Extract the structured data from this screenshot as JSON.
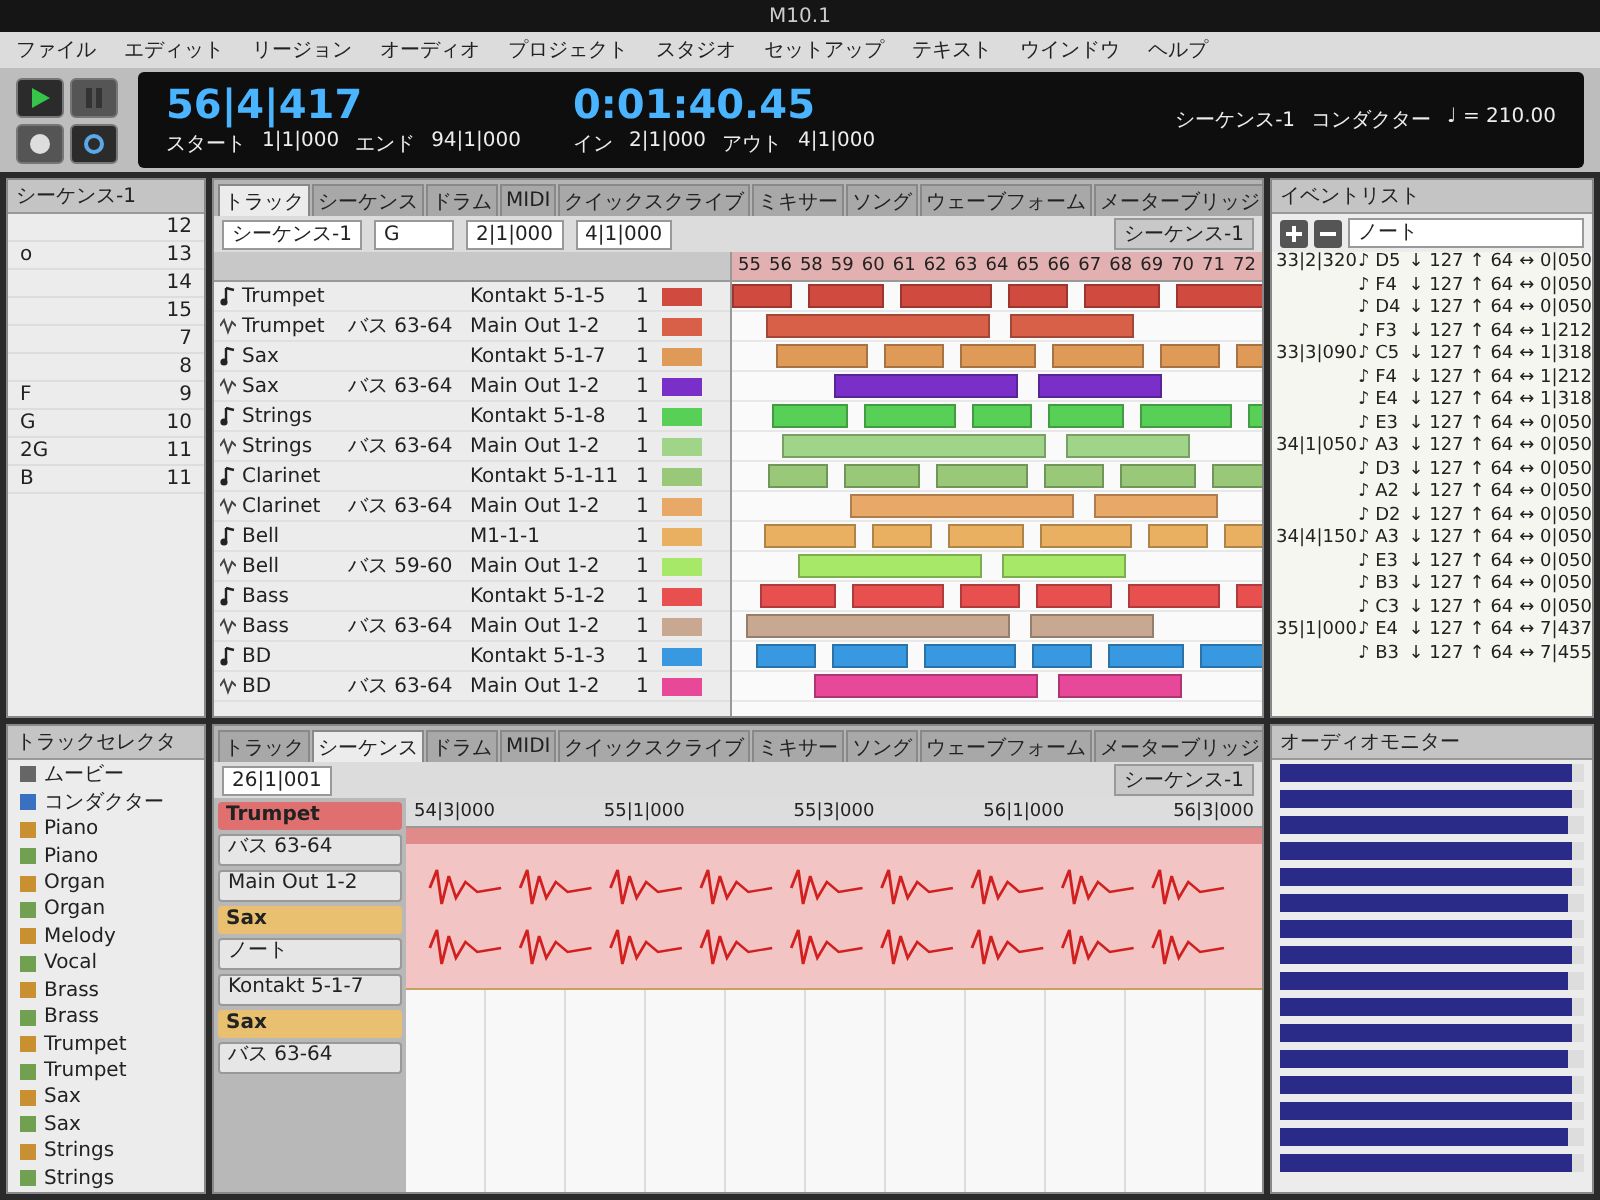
{
  "window": {
    "title": "M10.1"
  },
  "menu": [
    "ファイル",
    "エディット",
    "リージョン",
    "オーディオ",
    "プロジェクト",
    "スタジオ",
    "セットアップ",
    "テキスト",
    "ウインドウ",
    "ヘルプ"
  ],
  "transport": {
    "buttons": [
      {
        "kind": "play",
        "on": true
      },
      {
        "kind": "pause",
        "on": false
      },
      {
        "kind": "record",
        "on": false
      },
      {
        "kind": "loop",
        "on": true
      }
    ],
    "counter": "56|4|417",
    "start_label": "スタート",
    "start": "1|1|000",
    "end_label": "エンド",
    "end": "94|1|000",
    "time": "0:01:40.45",
    "in_label": "イン",
    "in": "2|1|000",
    "out_label": "アウト",
    "out": "4|1|000",
    "sequence": "シーケンス-1",
    "conductor": "コンダクター",
    "tempo": "♩ = 210.00"
  },
  "sequence_list": {
    "title": "シーケンス-1",
    "rows": [
      {
        "number": "12"
      },
      {
        "name": "o",
        "number": "13"
      },
      {
        "number": "14"
      },
      {
        "number": "15"
      },
      {
        "number": "7"
      },
      {
        "number": "8"
      },
      {
        "name": "F",
        "number": "9"
      },
      {
        "name": "G",
        "number": "10"
      },
      {
        "name": "2G",
        "number": "11"
      },
      {
        "name": "B",
        "number": "11"
      }
    ]
  },
  "tracks_window": {
    "title": "シーケンス-1",
    "tabs": [
      {
        "label": "トラック",
        "selected": true
      },
      {
        "label": "シーケンス",
        "selected": false
      },
      {
        "label": "ドラム",
        "selected": false
      },
      {
        "label": "MIDI",
        "selected": false
      },
      {
        "label": "クイックスクライブ",
        "selected": false
      },
      {
        "label": "ミキサー",
        "selected": false
      },
      {
        "label": "ソング",
        "selected": false
      },
      {
        "label": "ウェーブフォーム",
        "selected": false
      },
      {
        "label": "メーターブリッジ",
        "selected": false
      }
    ],
    "sequence_select": "シーケンス-1",
    "filter_select": "G",
    "from": "2|1|000",
    "to": "4|1|000",
    "ruler": [
      "55",
      "56",
      "58",
      "59",
      "60",
      "61",
      "62",
      "63",
      "64",
      "65",
      "66",
      "67",
      "68",
      "69",
      "70",
      "71",
      "72"
    ],
    "tracks": [
      {
        "kind": "midi",
        "name": "Trumpet",
        "device": "Kontakt 5-1-5",
        "channel": "1",
        "color": "#d04a40"
      },
      {
        "kind": "audio",
        "name": "Trumpet",
        "output": "バス 63-64",
        "device": "Main Out 1-2",
        "channel": "1",
        "color": "#d86048"
      },
      {
        "kind": "midi",
        "name": "Sax",
        "device": "Kontakt 5-1-7",
        "channel": "1",
        "color": "#e09a58"
      },
      {
        "kind": "audio",
        "name": "Sax",
        "output": "バス 63-64",
        "device": "Main Out 1-2",
        "channel": "1",
        "color": "#7a30c8"
      },
      {
        "kind": "midi",
        "name": "Strings",
        "device": "Kontakt 5-1-8",
        "channel": "1",
        "color": "#58d058"
      },
      {
        "kind": "audio",
        "name": "Strings",
        "output": "バス 63-64",
        "device": "Main Out 1-2",
        "channel": "1",
        "color": "#a0d488"
      },
      {
        "kind": "midi",
        "name": "Clarinet",
        "device": "Kontakt 5-1-11",
        "channel": "1",
        "color": "#98c878"
      },
      {
        "kind": "audio",
        "name": "Clarinet",
        "output": "バス 63-64",
        "device": "Main Out 1-2",
        "channel": "1",
        "color": "#e8a868"
      },
      {
        "kind": "midi",
        "name": "Bell",
        "device": "M1-1-1",
        "channel": "1",
        "color": "#e8b060"
      },
      {
        "kind": "audio",
        "name": "Bell",
        "output": "バス 59-60",
        "device": "Main Out 1-2",
        "channel": "1",
        "color": "#a8e868"
      },
      {
        "kind": "midi",
        "name": "Bass",
        "device": "Kontakt 5-1-2",
        "channel": "1",
        "color": "#e85050"
      },
      {
        "kind": "audio",
        "name": "Bass",
        "output": "バス 63-64",
        "device": "Main Out 1-2",
        "channel": "1",
        "color": "#c8a890"
      },
      {
        "kind": "midi",
        "name": "BD",
        "device": "Kontakt 5-1-3",
        "channel": "1",
        "color": "#3898e0"
      },
      {
        "kind": "audio",
        "name": "BD",
        "output": "バス 63-64",
        "device": "Main Out 1-2",
        "channel": "1",
        "color": "#e84898"
      }
    ]
  },
  "event_list": {
    "title": "イベントリスト",
    "filter": "ノート",
    "groups": [
      {
        "time": "33|2|320",
        "events": [
          {
            "note": "♪ D5",
            "on": "↓ 127",
            "off": "↑ 64",
            "dur": "↔ 0|050"
          },
          {
            "note": "♪ F4",
            "on": "↓ 127",
            "off": "↑ 64",
            "dur": "↔ 0|050"
          },
          {
            "note": "♪ D4",
            "on": "↓ 127",
            "off": "↑ 64",
            "dur": "↔ 0|050"
          },
          {
            "note": "♪ F3",
            "on": "↓ 127",
            "off": "↑ 64",
            "dur": "↔ 1|212"
          }
        ]
      },
      {
        "time": "33|3|090",
        "events": [
          {
            "note": "♪ C5",
            "on": "↓ 127",
            "off": "↑ 64",
            "dur": "↔ 1|318"
          },
          {
            "note": "♪ F4",
            "on": "↓ 127",
            "off": "↑ 64",
            "dur": "↔ 1|212"
          },
          {
            "note": "♪ E4",
            "on": "↓ 127",
            "off": "↑ 64",
            "dur": "↔ 1|318"
          },
          {
            "note": "♪ E3",
            "on": "↓ 127",
            "off": "↑ 64",
            "dur": "↔ 0|050"
          }
        ]
      },
      {
        "time": "34|1|050",
        "events": [
          {
            "note": "♪ A3",
            "on": "↓ 127",
            "off": "↑ 64",
            "dur": "↔ 0|050"
          },
          {
            "note": "♪ D3",
            "on": "↓ 127",
            "off": "↑ 64",
            "dur": "↔ 0|050"
          },
          {
            "note": "♪ A2",
            "on": "↓ 127",
            "off": "↑ 64",
            "dur": "↔ 0|050"
          },
          {
            "note": "♪ D2",
            "on": "↓ 127",
            "off": "↑ 64",
            "dur": "↔ 0|050"
          }
        ]
      },
      {
        "time": "34|4|150",
        "events": [
          {
            "note": "♪ A3",
            "on": "↓ 127",
            "off": "↑ 64",
            "dur": "↔ 0|050"
          },
          {
            "note": "♪ E3",
            "on": "↓ 127",
            "off": "↑ 64",
            "dur": "↔ 0|050"
          },
          {
            "note": "♪ B3",
            "on": "↓ 127",
            "off": "↑ 64",
            "dur": "↔ 0|050"
          },
          {
            "note": "♪ C3",
            "on": "↓ 127",
            "off": "↑ 64",
            "dur": "↔ 0|050"
          }
        ]
      },
      {
        "time": "35|1|000",
        "events": [
          {
            "note": "♪ E4",
            "on": "↓ 127",
            "off": "↑ 64",
            "dur": "↔ 7|437"
          },
          {
            "note": "♪ B3",
            "on": "↓ 127",
            "off": "↑ 64",
            "dur": "↔ 7|455"
          }
        ]
      }
    ]
  },
  "track_selector": {
    "title": "トラックセレクタ",
    "items": [
      {
        "kind": "movie",
        "name": "ムービー"
      },
      {
        "kind": "conductor",
        "name": "コンダクター"
      },
      {
        "kind": "midi",
        "name": "Piano"
      },
      {
        "kind": "audio",
        "name": "Piano"
      },
      {
        "kind": "midi",
        "name": "Organ"
      },
      {
        "kind": "audio",
        "name": "Organ"
      },
      {
        "kind": "midi",
        "name": "Melody"
      },
      {
        "kind": "audio",
        "name": "Vocal"
      },
      {
        "kind": "midi",
        "name": "Brass"
      },
      {
        "kind": "audio",
        "name": "Brass"
      },
      {
        "kind": "midi",
        "name": "Trumpet"
      },
      {
        "kind": "audio",
        "name": "Trumpet"
      },
      {
        "kind": "midi",
        "name": "Sax"
      },
      {
        "kind": "audio",
        "name": "Sax"
      },
      {
        "kind": "midi",
        "name": "Strings"
      },
      {
        "kind": "audio",
        "name": "Strings"
      }
    ]
  },
  "sequence_window": {
    "title": "シーケンス-1",
    "tabs": [
      {
        "label": "トラック",
        "selected": false
      },
      {
        "label": "シーケンス",
        "selected": true
      },
      {
        "label": "ドラム",
        "selected": false
      },
      {
        "label": "MIDI",
        "selected": false
      },
      {
        "label": "クイックスクライブ",
        "selected": false
      },
      {
        "label": "ミキサー",
        "selected": false
      },
      {
        "label": "ソング",
        "selected": false
      },
      {
        "label": "ウェーブフォーム",
        "selected": false
      },
      {
        "label": "メーターブリッジ",
        "selected": false
      }
    ],
    "location": "26|1|001",
    "ruler": [
      "54|3|000",
      "55|1|000",
      "55|3|000",
      "56|1|000",
      "56|3|000"
    ],
    "inspector": [
      {
        "kind": "track",
        "label": "Trumpet",
        "color": "#e07070"
      },
      {
        "kind": "field",
        "label": "バス 63-64"
      },
      {
        "kind": "field",
        "label": "Main Out 1-2"
      },
      {
        "kind": "track",
        "label": "Sax",
        "color": "#e8c070"
      },
      {
        "kind": "field",
        "label": "ノート"
      },
      {
        "kind": "field",
        "label": "Kontakt 5-1-7"
      },
      {
        "kind": "track",
        "label": "Sax",
        "color": "#e8c070"
      },
      {
        "kind": "field",
        "label": "バス 63-64"
      }
    ]
  },
  "audio_monitor": {
    "title": "オーディオモニター",
    "meters": [
      {
        "level": 0.96
      },
      {
        "level": 0.96
      },
      {
        "level": 0.95
      },
      {
        "level": 0.96
      },
      {
        "level": 0.96
      },
      {
        "level": 0.95
      },
      {
        "level": 0.96
      },
      {
        "level": 0.96
      },
      {
        "level": 0.95
      },
      {
        "level": 0.96
      },
      {
        "level": 0.96
      },
      {
        "level": 0.95
      },
      {
        "level": 0.96
      },
      {
        "level": 0.96
      },
      {
        "level": 0.95
      },
      {
        "level": 0.96
      }
    ]
  }
}
